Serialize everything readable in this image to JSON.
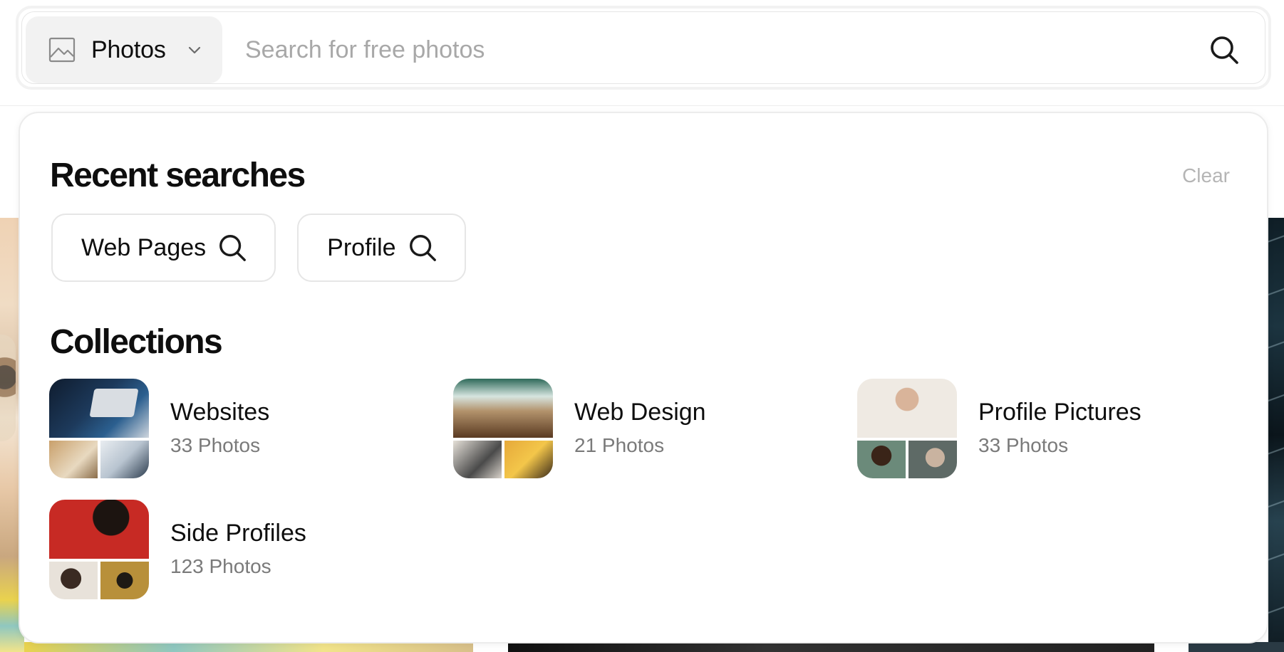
{
  "search": {
    "type_label": "Photos",
    "placeholder": "Search for free photos",
    "value": ""
  },
  "recent": {
    "title": "Recent searches",
    "clear_label": "Clear",
    "items": [
      {
        "label": "Web Pages"
      },
      {
        "label": "Profile"
      }
    ]
  },
  "collections": {
    "title": "Collections",
    "items": [
      {
        "name": "Websites",
        "count": "33 Photos"
      },
      {
        "name": "Web Design",
        "count": "21 Photos"
      },
      {
        "name": "Profile Pictures",
        "count": "33 Photos"
      },
      {
        "name": "Side Profiles",
        "count": "123 Photos"
      }
    ]
  },
  "icons": {
    "type": "image-icon",
    "dropdown": "chevron-down-icon",
    "search": "search-icon"
  },
  "colors": {
    "text": "#0e0e0e",
    "muted": "#7a7a7a",
    "placeholder": "#a8a8a8",
    "chip_border": "#e6e6e6",
    "select_bg": "#f2f2f2"
  }
}
